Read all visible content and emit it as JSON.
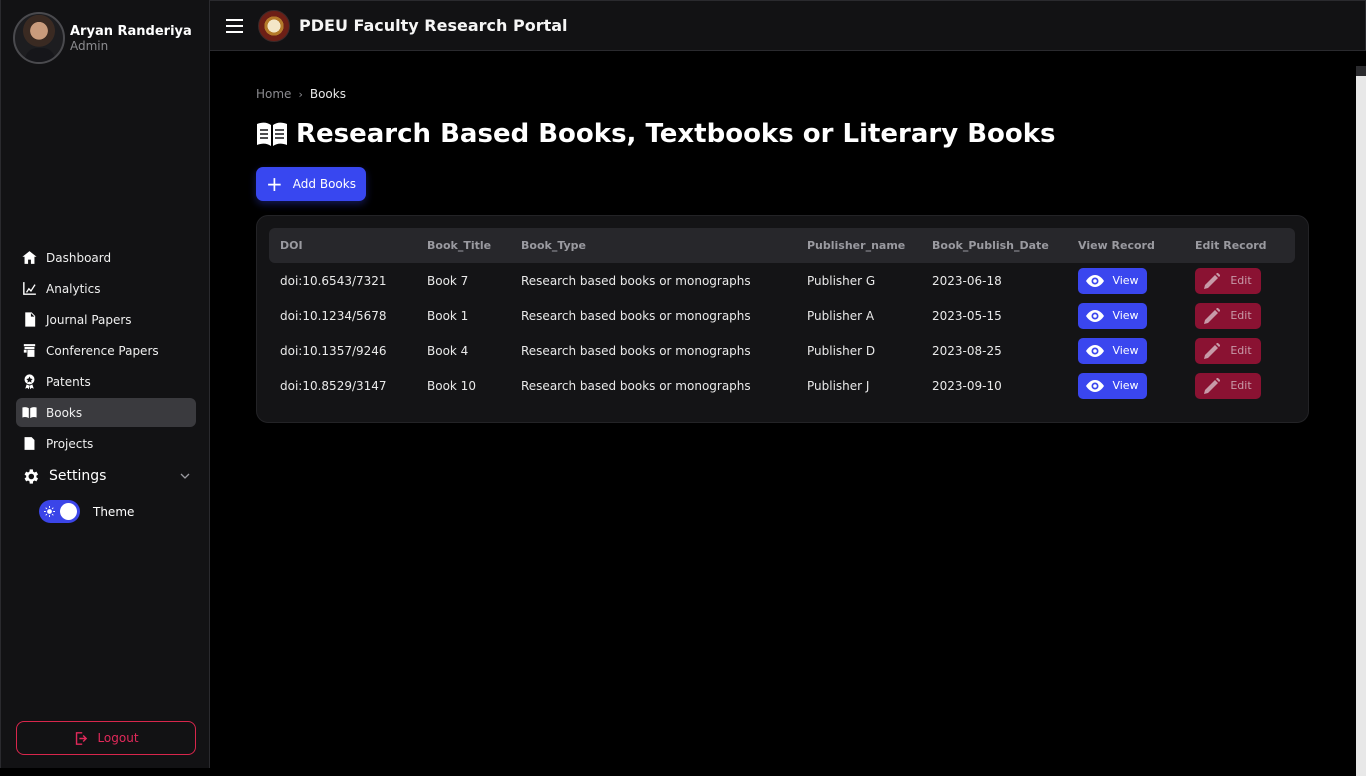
{
  "profile": {
    "name": "Aryan Randeriya",
    "role": "Admin"
  },
  "header": {
    "title": "PDEU Faculty Research Portal"
  },
  "sidebar": {
    "items": [
      {
        "label": "Dashboard",
        "icon": "home-icon"
      },
      {
        "label": "Analytics",
        "icon": "analytics-icon"
      },
      {
        "label": "Journal Papers",
        "icon": "document-icon"
      },
      {
        "label": "Conference Papers",
        "icon": "presentation-icon"
      },
      {
        "label": "Patents",
        "icon": "award-icon"
      },
      {
        "label": "Books",
        "icon": "book-icon",
        "active": true
      },
      {
        "label": "Projects",
        "icon": "project-icon"
      }
    ],
    "settings_label": "Settings",
    "theme_label": "Theme",
    "logout_label": "Logout"
  },
  "breadcrumb": {
    "home": "Home",
    "current": "Books"
  },
  "page": {
    "title": "Research Based Books, Textbooks or Literary Books",
    "add_label": "Add Books"
  },
  "table": {
    "columns": [
      "DOI",
      "Book_Title",
      "Book_Type",
      "Publisher_name",
      "Book_Publish_Date",
      "View Record",
      "Edit Record"
    ],
    "rows": [
      {
        "doi": "doi:10.6543/7321",
        "title": "Book 7",
        "type": "Research based books or monographs",
        "publisher": "Publisher G",
        "date": "2023-06-18"
      },
      {
        "doi": "doi:10.1234/5678",
        "title": "Book 1",
        "type": "Research based books or monographs",
        "publisher": "Publisher A",
        "date": "2023-05-15"
      },
      {
        "doi": "doi:10.1357/9246",
        "title": "Book 4",
        "type": "Research based books or monographs",
        "publisher": "Publisher D",
        "date": "2023-08-25"
      },
      {
        "doi": "doi:10.8529/3147",
        "title": "Book 10",
        "type": "Research based books or monographs",
        "publisher": "Publisher J",
        "date": "2023-09-10"
      }
    ],
    "view_label": "View",
    "edit_label": "Edit"
  },
  "colors": {
    "accent": "#3a46ef",
    "danger": "#8a1232",
    "logout": "#e1295a"
  }
}
